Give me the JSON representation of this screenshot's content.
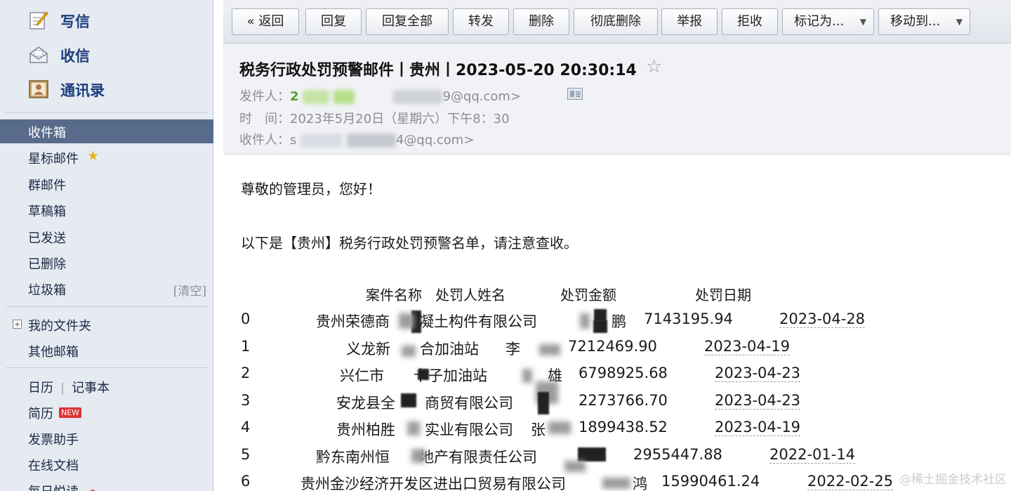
{
  "sidebar": {
    "compose": "写信",
    "inbox_top": "收信",
    "contacts": "通讯录",
    "folders": [
      "收件箱",
      "星标邮件",
      "群邮件",
      "草稿箱",
      "已发送",
      "已删除",
      "垃圾箱"
    ],
    "clear": "[清空]",
    "my_folders": "我的文件夹",
    "other_mailboxes": "其他邮箱",
    "calendar": "日历",
    "notepad": "记事本",
    "resume": "简历",
    "new_badge": "NEW",
    "invoice_helper": "发票助手",
    "online_docs": "在线文档",
    "daily_read": "每日悦读"
  },
  "toolbar": {
    "back": "« 返回",
    "reply": "回复",
    "reply_all": "回复全部",
    "forward": "转发",
    "delete": "删除",
    "delete_perm": "彻底删除",
    "report": "举报",
    "reject": "拒收",
    "mark_as": "标记为...",
    "move_to": "移动到..."
  },
  "email": {
    "subject": "税务行政处罚预警邮件丨贵州丨2023-05-20 20:30:14",
    "from_label": "发件人：",
    "from_prefix": "2",
    "from_suffix": "9@qq.com>",
    "time_label": "时　间：",
    "time_value": "2023年5月20日（星期六）下午8：30",
    "to_label": "收件人：",
    "to_prefix": "s",
    "to_suffix": "4@qq.com>",
    "greeting": "尊敬的管理员，您好！",
    "intro": "以下是【贵州】税务行政处罚预警名单，请注意查收。",
    "table_header": {
      "case_name": "案件名称",
      "person": "处罚人姓名",
      "amount": "处罚金额",
      "date": "处罚日期"
    },
    "rows": [
      {
        "idx": "0",
        "name": "贵州荣德商　　凝土构件有限公司",
        "person": "鹏",
        "amount": "7143195.94",
        "date": "2023-04-28"
      },
      {
        "idx": "1",
        "name": "义龙新　　合加油站",
        "person": "李　　",
        "amount": "7212469.90",
        "date": "2023-04-19"
      },
      {
        "idx": "2",
        "name": "兴仁市　　卡子加油站",
        "person": "雄",
        "amount": "6798925.68",
        "date": "2023-04-23"
      },
      {
        "idx": "3",
        "name": "安龙县全　　商贸有限公司",
        "person": "",
        "amount": "2273766.70",
        "date": "2023-04-23"
      },
      {
        "idx": "4",
        "name": "贵州柏胜　　实业有限公司",
        "person": "张",
        "amount": "1899438.52",
        "date": "2023-04-19"
      },
      {
        "idx": "5",
        "name": "黔东南州恒　　地产有限责任公司",
        "person": "",
        "amount": "2955447.88",
        "date": "2022-01-14"
      },
      {
        "idx": "6",
        "name": "贵州金沙经济开发区进出口贸易有限公司",
        "person": "鸿",
        "amount": "15990461.24",
        "date": "2022-02-25"
      }
    ]
  },
  "watermark": "@稀土掘金技术社区"
}
